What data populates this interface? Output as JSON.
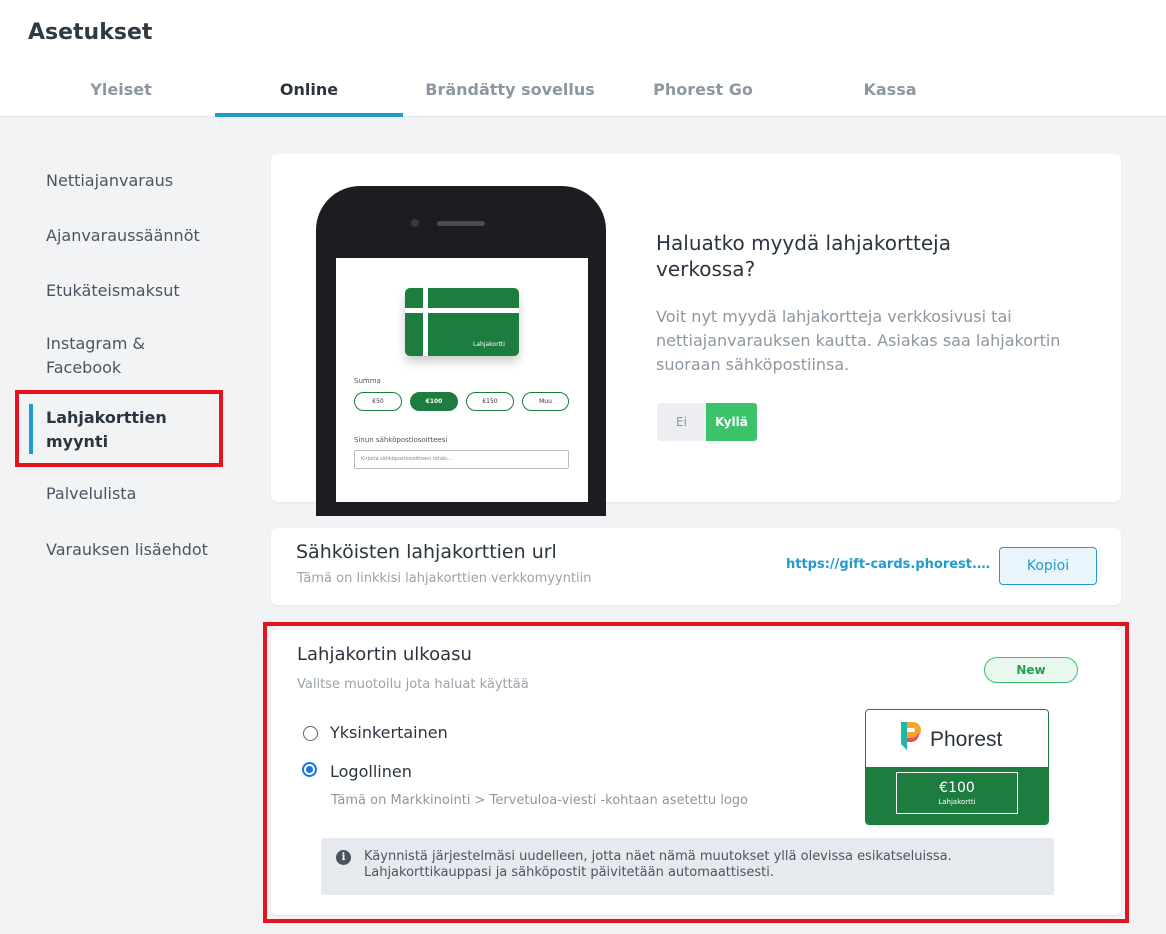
{
  "page": {
    "title": "Asetukset"
  },
  "tabs": [
    {
      "label": "Yleiset"
    },
    {
      "label": "Online"
    },
    {
      "label": "Brändätty sovellus"
    },
    {
      "label": "Phorest Go"
    },
    {
      "label": "Kassa"
    }
  ],
  "active_tab": "Online",
  "sidebar": {
    "items": [
      {
        "label": "Nettiajanvaraus"
      },
      {
        "label": "Ajanvaraussäännöt"
      },
      {
        "label": "Etukäteismaksut"
      },
      {
        "label": "Instagram & Facebook"
      },
      {
        "label": "Lahjakorttien myynti"
      },
      {
        "label": "Palvelulista"
      },
      {
        "label": "Varauksen lisäehdot"
      }
    ],
    "active": "Lahjakorttien myynti"
  },
  "promo": {
    "title": "Haluatko myydä lahjakortteja verkossa?",
    "text": "Voit nyt myydä lahjakortteja verkkosivusi tai nettiajanvarauksen kautta. Asiakas saa lahjakortin suoraan sähköpostiinsa.",
    "toggle_off": "Ei",
    "toggle_on": "Kyllä",
    "toggle_value": "Kyllä",
    "phone": {
      "card_label": "Lahjakortti",
      "amount_label": "Summa",
      "amounts": [
        "€50",
        "€100",
        "€150",
        "Muu"
      ],
      "selected_amount": "€100",
      "email_label": "Sinun sähköpostiosoitteesi",
      "email_placeholder": "Kirjoita sähköpostiosoitteesi tähän..."
    }
  },
  "url_section": {
    "title": "Sähköisten lahjakorttien url",
    "subtitle": "Tämä on linkkisi lahjakorttien verkkomyyntiin",
    "url": "https://gift-cards.phorest.c...",
    "copy_label": "Kopioi"
  },
  "design_section": {
    "title": "Lahjakortin ulkoasu",
    "subtitle": "Valitse muotoilu jota haluat käyttää",
    "badge": "New",
    "options": [
      {
        "label": "Yksinkertainen",
        "checked": false
      },
      {
        "label": "Logollinen",
        "checked": true
      }
    ],
    "logo_help": "Tämä on Markkinointi > Tervetuloa-viesti -kohtaan asetettu logo",
    "preview": {
      "brand": "Phorest",
      "amount": "€100",
      "label": "Lahjakortti"
    },
    "info_icon": "info-icon",
    "info_text": "Käynnistä järjestelmäsi uudelleen, jotta näet nämä muutokset yllä olevissa esikatseluissa. Lahjakorttikauppasi ja sähköpostit päivitetään automaattisesti."
  },
  "colors": {
    "accent": "#1f9bcf",
    "success": "#3bc26b",
    "brand_green": "#1c7d3f",
    "highlight_red": "#e3141d"
  }
}
